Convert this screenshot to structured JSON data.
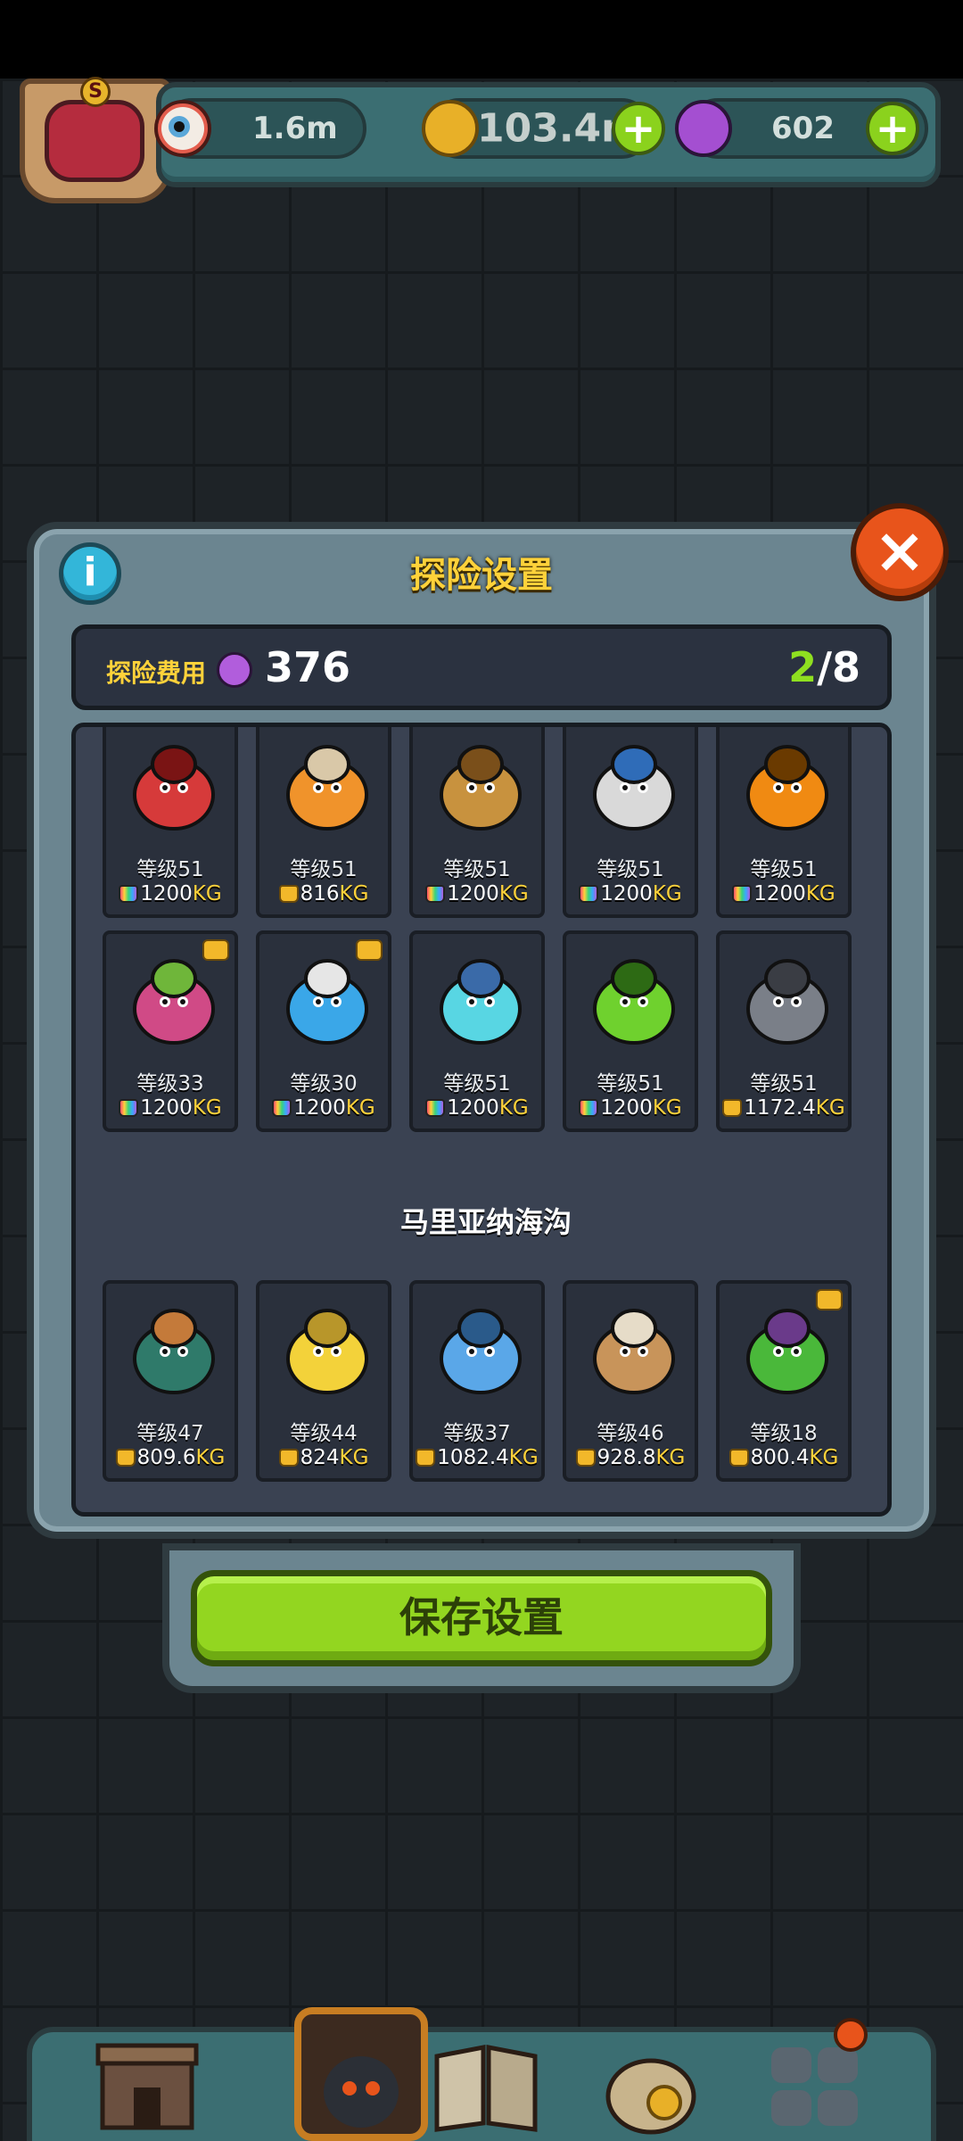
{
  "topbar": {
    "eye_value": "1.6m",
    "coin_value": "103.4m",
    "potion_value": "602",
    "avatar_letter": "S"
  },
  "dialog": {
    "title": "探险设置",
    "info_label": "i",
    "close_label": "×",
    "cost_label": "探险费用",
    "cost_value": "376",
    "slots_current": "2",
    "slots_total": "/8",
    "section_title": "马里亚纳海沟",
    "save_label": "保存设置"
  },
  "colors": {
    "accent_green": "#93d620",
    "title_yellow": "#ffd23a",
    "close_orange": "#e8541b"
  },
  "monsters": [
    {
      "level": "等级51",
      "weight": "1200",
      "unit": "KG",
      "bag": "rainbow",
      "icon": "red-toad-monster-icon",
      "badge": false
    },
    {
      "level": "等级51",
      "weight": "816",
      "unit": "KG",
      "bag": "gold",
      "icon": "mushroom-beast-icon",
      "badge": false
    },
    {
      "level": "等级51",
      "weight": "1200",
      "unit": "KG",
      "bag": "rainbow",
      "icon": "yeti-monster-icon",
      "badge": false
    },
    {
      "level": "等级51",
      "weight": "1200",
      "unit": "KG",
      "bag": "rainbow",
      "icon": "chainsaw-pig-icon",
      "badge": false
    },
    {
      "level": "等级51",
      "weight": "1200",
      "unit": "KG",
      "bag": "rainbow",
      "icon": "pumpkin-monster-icon",
      "badge": false
    },
    {
      "level": "等级33",
      "weight": "1200",
      "unit": "KG",
      "bag": "rainbow",
      "icon": "onion-plant-monster-icon",
      "badge": true
    },
    {
      "level": "等级30",
      "weight": "1200",
      "unit": "KG",
      "bag": "rainbow",
      "icon": "milk-snail-icon",
      "badge": true
    },
    {
      "level": "等级51",
      "weight": "1200",
      "unit": "KG",
      "bag": "rainbow",
      "icon": "fish-bowl-icon",
      "badge": false
    },
    {
      "level": "等级51",
      "weight": "1200",
      "unit": "KG",
      "bag": "rainbow",
      "icon": "green-caterpillar-icon",
      "badge": false
    },
    {
      "level": "等级51",
      "weight": "1172.4",
      "unit": "KG",
      "bag": "gold",
      "icon": "rock-golem-icon",
      "badge": false
    }
  ],
  "trench_monsters": [
    {
      "level": "等级47",
      "weight": "809.6",
      "unit": "KG",
      "bag": "gold",
      "icon": "sea-urchin-icon",
      "badge": false
    },
    {
      "level": "等级44",
      "weight": "824",
      "unit": "KG",
      "bag": "gold",
      "icon": "banana-squid-icon",
      "badge": false
    },
    {
      "level": "等级37",
      "weight": "1082.4",
      "unit": "KG",
      "bag": "gold",
      "icon": "blue-crab-icon",
      "badge": false
    },
    {
      "level": "等级46",
      "weight": "928.8",
      "unit": "KG",
      "bag": "gold",
      "icon": "walrus-shell-icon",
      "badge": false
    },
    {
      "level": "等级18",
      "weight": "800.4",
      "unit": "KG",
      "bag": "gold",
      "icon": "mantis-centipede-icon",
      "badge": true
    }
  ],
  "nav": [
    {
      "icon": "shop-building-icon"
    },
    {
      "icon": "dungeon-expedition-icon"
    },
    {
      "icon": "book-icon"
    },
    {
      "icon": "coin-bag-icon"
    },
    {
      "icon": "collection-grid-icon"
    }
  ]
}
